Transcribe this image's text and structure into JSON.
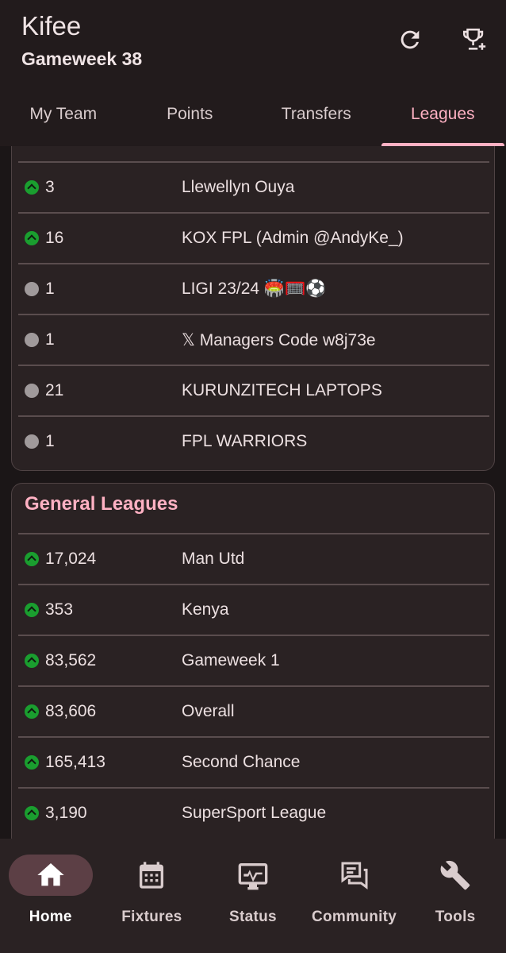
{
  "header": {
    "app_title": "Kifee",
    "subtitle": "Gameweek 38"
  },
  "tabs": [
    {
      "label": "My Team"
    },
    {
      "label": "Points"
    },
    {
      "label": "Transfers"
    },
    {
      "label": "Leagues",
      "active": true
    }
  ],
  "private_leagues": {
    "rows": [
      {
        "rank": "3",
        "trend": "up",
        "name": "Llewellyn Ouya"
      },
      {
        "rank": "16",
        "trend": "up",
        "name": "KOX FPL (Admin @AndyKe_)"
      },
      {
        "rank": "1",
        "trend": "same",
        "name": "LIGI 23/24 🏟️🥅⚽"
      },
      {
        "rank": "1",
        "trend": "same",
        "name": "𝕏 Managers Code w8j73e"
      },
      {
        "rank": "21",
        "trend": "same",
        "name": "KURUNZITECH LAPTOPS"
      },
      {
        "rank": "1",
        "trend": "same",
        "name": "FPL WARRIORS"
      }
    ]
  },
  "general_leagues": {
    "title": "General Leagues",
    "rows": [
      {
        "rank": "17,024",
        "trend": "up",
        "name": "Man Utd"
      },
      {
        "rank": "353",
        "trend": "up",
        "name": "Kenya"
      },
      {
        "rank": "83,562",
        "trend": "up",
        "name": "Gameweek 1"
      },
      {
        "rank": "83,606",
        "trend": "up",
        "name": "Overall"
      },
      {
        "rank": "165,413",
        "trend": "up",
        "name": "Second Chance"
      },
      {
        "rank": "3,190",
        "trend": "up",
        "name": "SuperSport League"
      }
    ]
  },
  "bottom_nav": [
    {
      "label": "Home",
      "icon": "home-icon",
      "active": true
    },
    {
      "label": "Fixtures",
      "icon": "calendar-icon"
    },
    {
      "label": "Status",
      "icon": "monitor-icon"
    },
    {
      "label": "Community",
      "icon": "forum-icon"
    },
    {
      "label": "Tools",
      "icon": "wrench-icon"
    }
  ],
  "colors": {
    "accent": "#ffb1c3",
    "trend_up": "#1a9e2f",
    "trend_same": "#a09a9b",
    "background": "#1b1617",
    "card": "#2a2223"
  }
}
